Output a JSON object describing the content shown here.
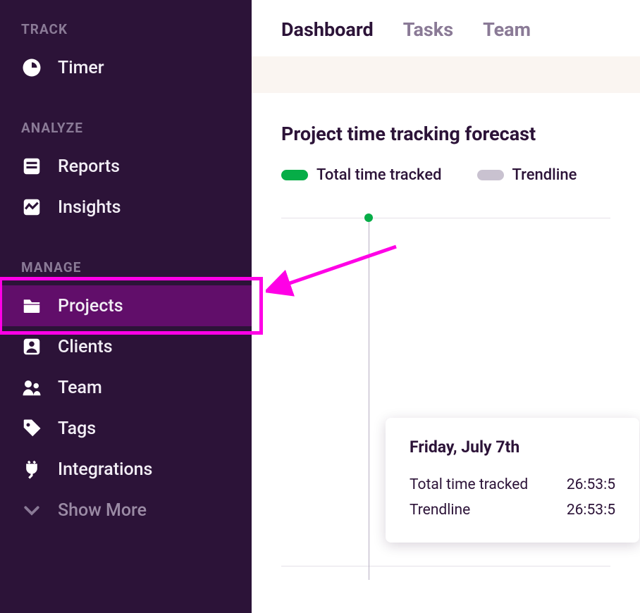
{
  "colors": {
    "sidebar_bg": "#2c1338",
    "highlight": "#ff00e6",
    "green": "#06ad47",
    "grey_pill": "#c9c2d0",
    "muted": "#8a7a96"
  },
  "sidebar": {
    "sections": [
      {
        "label": "TRACK",
        "items": [
          {
            "icon": "clock-icon",
            "label": "Timer",
            "show_more": false
          }
        ]
      },
      {
        "label": "ANALYZE",
        "items": [
          {
            "icon": "reports-icon",
            "label": "Reports",
            "show_more": false
          },
          {
            "icon": "insights-icon",
            "label": "Insights",
            "show_more": false
          }
        ]
      },
      {
        "label": "MANAGE",
        "items": [
          {
            "icon": "folder-icon",
            "label": "Projects",
            "highlighted": true,
            "show_more": false
          },
          {
            "icon": "client-icon",
            "label": "Clients",
            "show_more": false
          },
          {
            "icon": "team-icon",
            "label": "Team",
            "show_more": false
          },
          {
            "icon": "tag-icon",
            "label": "Tags",
            "show_more": false
          },
          {
            "icon": "plug-icon",
            "label": "Integrations",
            "show_more": false
          },
          {
            "icon": "chevron-down-icon",
            "label": "Show More",
            "show_more": true
          }
        ]
      }
    ]
  },
  "tabs": [
    {
      "label": "Dashboard",
      "active": true
    },
    {
      "label": "Tasks",
      "active": false
    },
    {
      "label": "Team",
      "active": false
    }
  ],
  "chart": {
    "title": "Project time tracking forecast",
    "legend": [
      {
        "label": "Total time tracked",
        "color": "#06ad47"
      },
      {
        "label": "Trendline",
        "color": "#c9c2d0"
      }
    ],
    "tooltip": {
      "title": "Friday, July 7th",
      "rows": [
        {
          "label": "Total time tracked",
          "value": "26:53:5"
        },
        {
          "label": "Trendline",
          "value": "26:53:5"
        }
      ]
    }
  },
  "chart_data": {
    "type": "line",
    "title": "Project time tracking forecast",
    "series": [
      {
        "name": "Total time tracked",
        "color": "#06ad47",
        "points": [
          {
            "x": "Friday, July 7th",
            "y": "26:53:5"
          }
        ]
      },
      {
        "name": "Trendline",
        "color": "#c9c2d0",
        "points": [
          {
            "x": "Friday, July 7th",
            "y": "26:53:5"
          }
        ]
      }
    ],
    "xlabel": "",
    "ylabel": "",
    "grid": true
  },
  "annotation": {
    "type": "arrow",
    "color": "#ff00e6",
    "target": "sidebar-item-projects"
  }
}
